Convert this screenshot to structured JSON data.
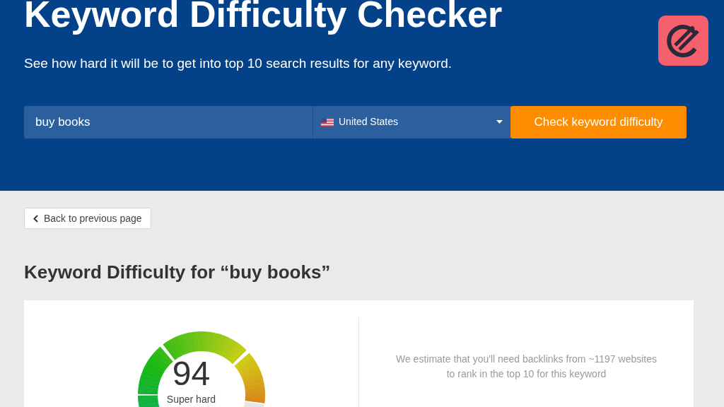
{
  "header": {
    "title": "Keyword Difficulty Checker",
    "subtitle": "See how hard it will be to get into top 10 search results for any keyword."
  },
  "search": {
    "keyword": "buy books",
    "country": "United States",
    "button": "Check keyword difficulty"
  },
  "back_link": "Back to previous page",
  "heading": "Keyword Difficulty for “buy books”",
  "difficulty": {
    "score": "94",
    "label": "Super hard"
  },
  "estimate": "We estimate that you'll need backlinks from ~1197 websites to rank in the top 10 for this keyword"
}
